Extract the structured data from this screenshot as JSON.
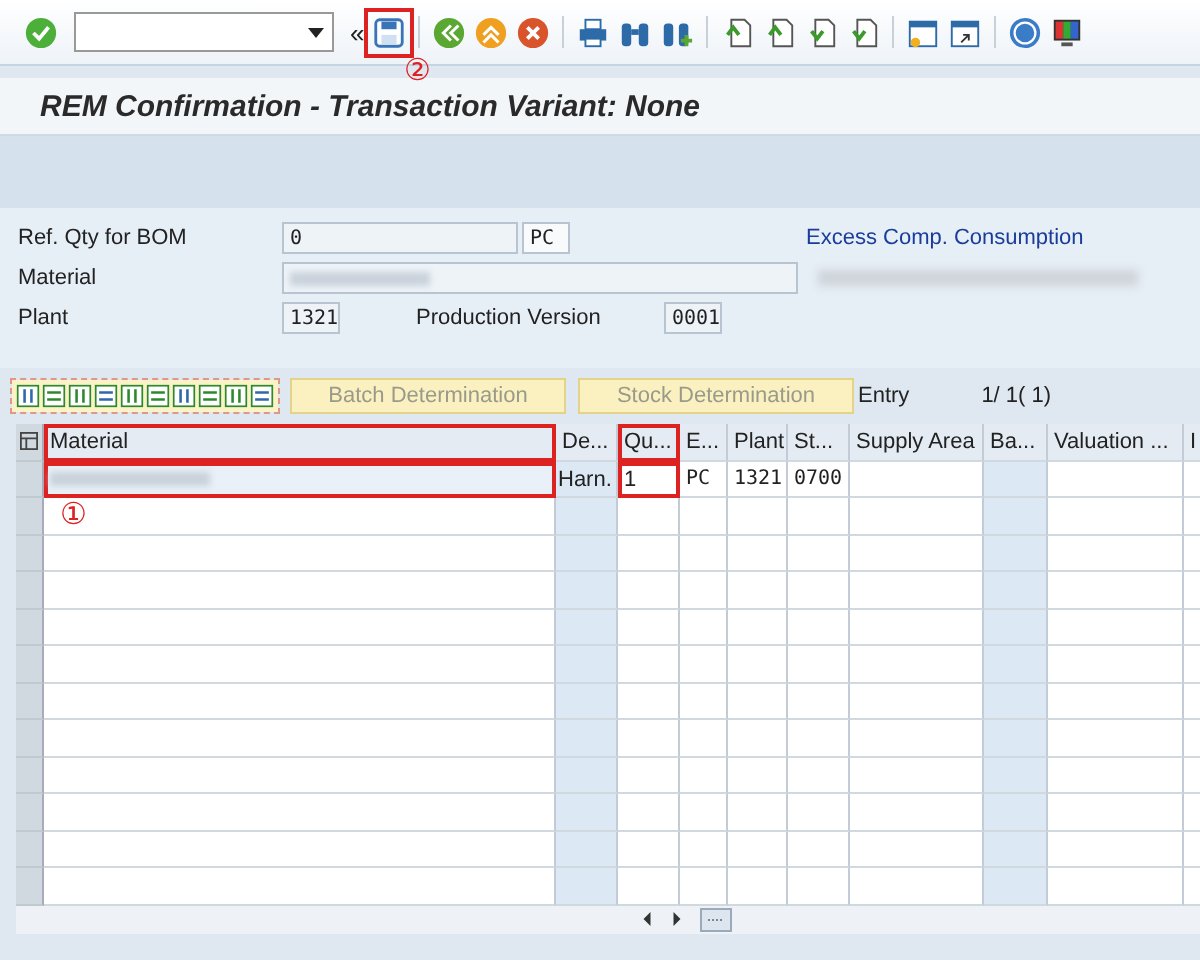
{
  "toolbar": {
    "collapse_glyph": "«"
  },
  "title": "REM Confirmation - Transaction Variant: None",
  "form": {
    "fields": [
      {
        "label": "Ref. Qty for BOM",
        "value": "0",
        "unit": "PC"
      },
      {
        "label": "Material",
        "value_redacted": true
      },
      {
        "label": "Plant",
        "value": "1321"
      }
    ],
    "production_version": {
      "label": "Production Version",
      "value": "0001"
    },
    "link": "Excess Comp. Consumption"
  },
  "table_toolbar": {
    "buttons": [
      {
        "label": "Batch Determination",
        "disabled": true
      },
      {
        "label": "Stock Determination",
        "disabled": true
      }
    ],
    "entry_label": "Entry",
    "entry_count": "1/ 1( 1)"
  },
  "table": {
    "columns": [
      {
        "label": "Material",
        "editable": true
      },
      {
        "label": "De...",
        "editable": false
      },
      {
        "label": "Qu...",
        "editable": true
      },
      {
        "label": "E...",
        "editable": true
      },
      {
        "label": "Plant",
        "editable": true
      },
      {
        "label": "St...",
        "editable": true
      },
      {
        "label": "Supply Area",
        "editable": true
      },
      {
        "label": "Ba...",
        "editable": false
      },
      {
        "label": "Valuation ...",
        "editable": true
      },
      {
        "label": "I",
        "editable": true
      }
    ],
    "rows": [
      {
        "cells": [
          "",
          "Harn.",
          "1",
          "PC",
          "1321",
          "0700",
          "",
          "",
          "",
          ""
        ],
        "material_redacted": true
      }
    ]
  },
  "annotations": [
    "①",
    "②"
  ]
}
